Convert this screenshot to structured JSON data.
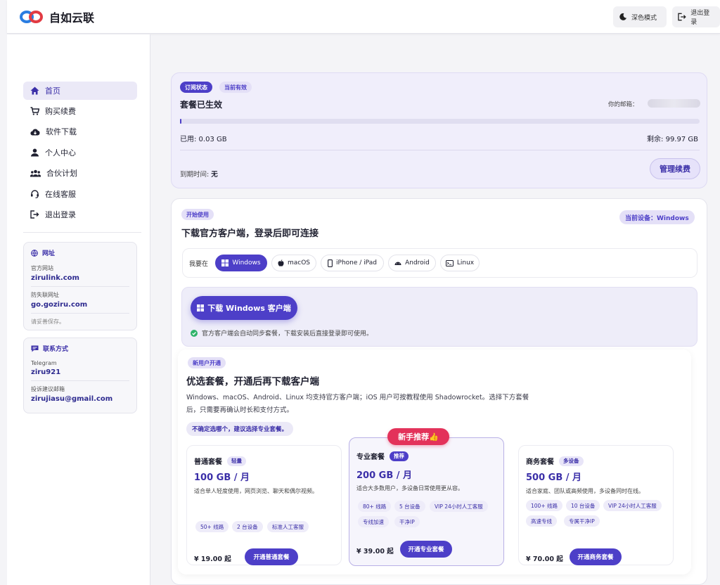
{
  "brand": {
    "name": "自如云联"
  },
  "header": {
    "dark_mode": "深色模式",
    "logout": "退出登录"
  },
  "sidebar": {
    "items": [
      {
        "label": "首页"
      },
      {
        "label": "购买续费"
      },
      {
        "label": "软件下载"
      },
      {
        "label": "个人中心"
      },
      {
        "label": "合伙计划"
      },
      {
        "label": "在线客服"
      },
      {
        "label": "退出登录"
      }
    ],
    "sites": {
      "title": "网址",
      "official_label": "官方网站",
      "official_url": "zirulink.com",
      "backup_label": "防失联网址",
      "backup_url": "go.goziru.com",
      "note": "请妥善保存。"
    },
    "contact": {
      "title": "联系方式",
      "telegram_label": "Telegram",
      "telegram": "ziru921",
      "email_label": "投诉建议邮箱",
      "email": "zirujiasu@gmail.com"
    }
  },
  "subscription": {
    "tag": "订阅状态",
    "status_tag": "当前有效",
    "title": "套餐已生效",
    "email_label": "你的邮箱：",
    "used": "已用: 0.03 GB",
    "remaining": "剩余: 99.97 GB",
    "used_fraction": 0.0003,
    "expiry_label": "到期时间: ",
    "expiry_value": "无",
    "manage_button": "管理续费"
  },
  "download": {
    "tag": "开始使用",
    "title": "下载官方客户端，登录后即可连接",
    "current_device": "当前设备：Windows",
    "platform_label": "我要在",
    "platforms": [
      "Windows",
      "macOS",
      "iPhone / iPad",
      "Android",
      "Linux"
    ],
    "selected_platform": "Windows",
    "button": "下载 Windows 客户端",
    "note": "官方客户端会自动同步套餐，下载安装后直接登录即可使用。"
  },
  "plans_section": {
    "tag": "新用户开通",
    "title": "优选套餐，开通后再下载客户端",
    "intro": "Windows、macOS、Android、Linux 均支持官方客户端；iOS 用户可按教程使用 Shadowrocket。选择下方套餐后，只需要再确认时长和支付方式。",
    "hint": "不确定选哪个，建议选择专业套餐。",
    "recommend_badge": "新手推荐👍",
    "plans": [
      {
        "name": "普通套餐",
        "tag": "轻量",
        "price": "100 GB / 月",
        "desc": "适合单人轻度使用，网页浏览、聊天和偶尔视频。",
        "features": [
          "50+ 线路",
          "2 台设备",
          "标准人工客服"
        ],
        "cost": "¥ 19.00 起",
        "button": "开通普通套餐"
      },
      {
        "name": "专业套餐",
        "tag": "推荐",
        "price": "200 GB / 月",
        "desc": "适合大多数用户，多设备日常使用更从容。",
        "features": [
          "80+ 线路",
          "5 台设备",
          "VIP 24小时人工客服",
          "专线加速",
          "干净IP"
        ],
        "cost": "¥ 39.00 起",
        "button": "开通专业套餐"
      },
      {
        "name": "商务套餐",
        "tag": "多设备",
        "price": "500 GB / 月",
        "desc": "适合家庭、团队或高频使用，多设备同时在线。",
        "features": [
          "100+ 线路",
          "10 台设备",
          "VIP 24小时人工客服",
          "高速专线",
          "专属干净IP"
        ],
        "cost": "¥ 70.00 起",
        "button": "开通商务套餐"
      }
    ]
  }
}
